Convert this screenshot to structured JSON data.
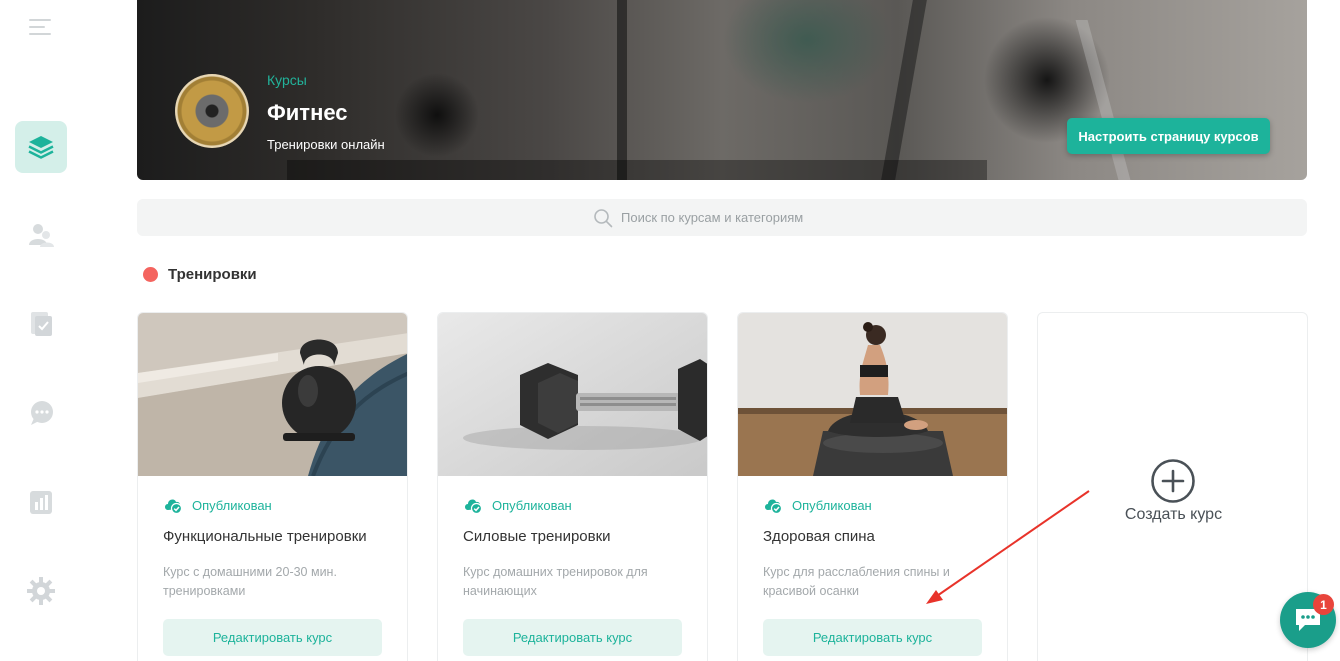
{
  "hero": {
    "category": "Курсы",
    "title": "Фитнес",
    "subtitle": "Тренировки онлайн",
    "settings_button": "Настроить страницу курсов"
  },
  "search": {
    "placeholder": "Поиск по курсам и категориям"
  },
  "category": {
    "label": "Тренировки",
    "dot_color": "#f4645f"
  },
  "colors": {
    "accent": "#1db39b",
    "accent_light": "#e5f4f0"
  },
  "cards": [
    {
      "status": "Опубликован",
      "title": "Функциональные тренировки",
      "description": "Курс с домашними 20-30 мин. тренировками",
      "button": "Редактировать курс"
    },
    {
      "status": "Опубликован",
      "title": "Силовые тренировки",
      "description": "Курс домашних тренировок для начинающих",
      "button": "Редактировать курс"
    },
    {
      "status": "Опубликован",
      "title": "Здоровая спина",
      "description": "Курс для расслабления спины и красивой осанки",
      "button": "Редактировать курс"
    }
  ],
  "create_card": {
    "label": "Создать курс"
  },
  "chat": {
    "badge_count": "1"
  },
  "sidebar": {
    "icons": [
      "menu-icon",
      "courses-stack-icon",
      "users-icon",
      "document-check-icon",
      "chat-bubbles-icon",
      "analytics-icon",
      "settings-gear-icon"
    ]
  }
}
